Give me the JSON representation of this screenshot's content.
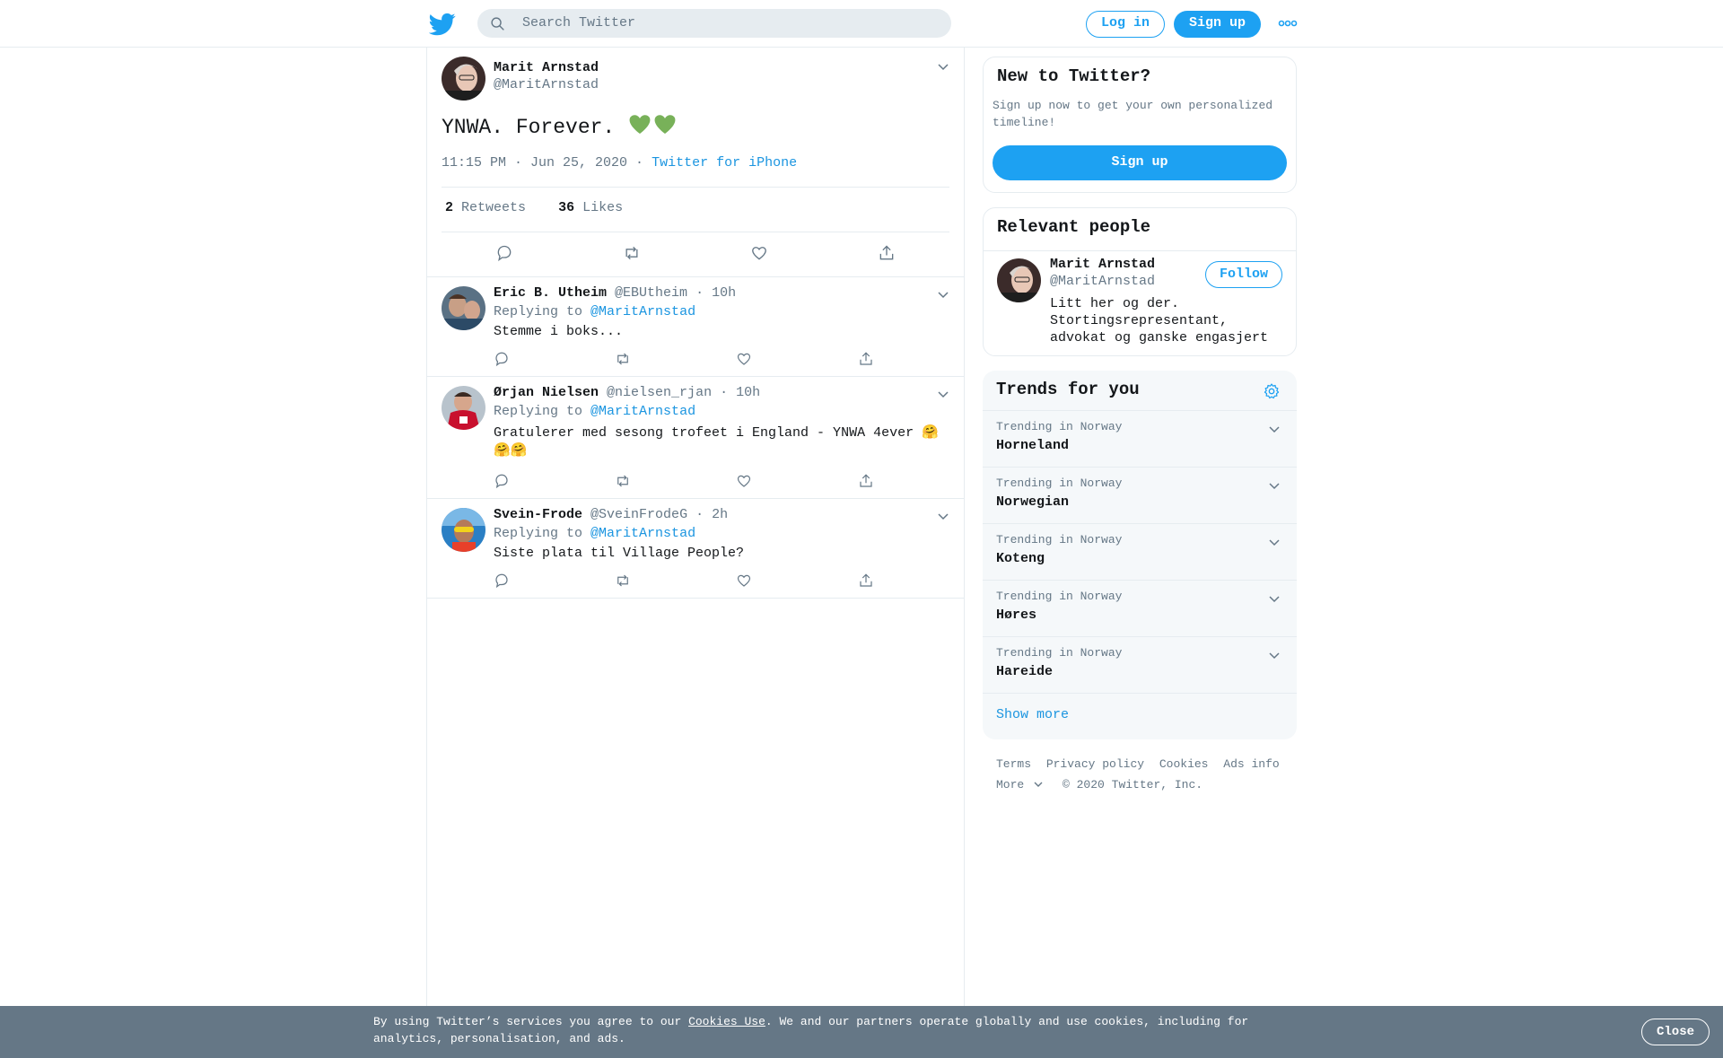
{
  "header": {
    "search_placeholder": "Search Twitter",
    "login_label": "Log in",
    "signup_label": "Sign up"
  },
  "focal_tweet": {
    "author_name": "Marit Arnstad",
    "author_handle": "@MaritArnstad",
    "text": "YNWA. Forever.",
    "emoji": "💚💚",
    "time": "11:15 PM · Jun 25, 2020 ·",
    "source": "Twitter for iPhone",
    "retweets_count": "2",
    "retweets_label": "Retweets",
    "likes_count": "36",
    "likes_label": "Likes"
  },
  "replies": [
    {
      "name": "Eric B. Utheim",
      "handle": "@EBUtheim",
      "time": "· 10h",
      "replying_prefix": "Replying to",
      "replying_to": "@MaritArnstad",
      "text": "Stemme i boks..."
    },
    {
      "name": "Ørjan Nielsen",
      "handle": "@nielsen_rjan",
      "time": "· 10h",
      "replying_prefix": "Replying to",
      "replying_to": "@MaritArnstad",
      "text": "Gratulerer med sesong trofeet i England - YNWA 4ever 🤗🤗🤗"
    },
    {
      "name": "Svein-Frode",
      "handle": "@SveinFrodeG",
      "time": "· 2h",
      "replying_prefix": "Replying to",
      "replying_to": "@MaritArnstad",
      "text": "Siste plata til Village People?"
    }
  ],
  "sidebar": {
    "new_title": "New to Twitter?",
    "new_sub": "Sign up now to get your own personalized timeline!",
    "new_button": "Sign up",
    "people_title": "Relevant people",
    "person_name": "Marit Arnstad",
    "person_handle": "@MaritArnstad",
    "person_bio": "Litt her og der. Stortingsrepresentant, advokat og ganske engasjert",
    "follow_label": "Follow",
    "trends_title": "Trends for you",
    "trends": [
      {
        "context": "Trending in Norway",
        "name": "Horneland"
      },
      {
        "context": "Trending in Norway",
        "name": "Norwegian"
      },
      {
        "context": "Trending in Norway",
        "name": "Koteng"
      },
      {
        "context": "Trending in Norway",
        "name": "Høres"
      },
      {
        "context": "Trending in Norway",
        "name": "Hareide"
      }
    ],
    "show_more": "Show more"
  },
  "footer": {
    "terms": "Terms",
    "privacy": "Privacy policy",
    "cookies": "Cookies",
    "ads": "Ads info",
    "more": "More",
    "copyright": "© 2020 Twitter, Inc."
  },
  "cookie_banner": {
    "text_before": "By using Twitter’s services you agree to our ",
    "link": "Cookies Use",
    "text_after": ". We and our partners operate globally and use cookies, including for analytics, personalisation, and ads.",
    "close_label": "Close"
  },
  "colors": {
    "accent": "#1da1f2",
    "link": "#1b95e0",
    "muted": "#657786",
    "banner": "#657786"
  }
}
